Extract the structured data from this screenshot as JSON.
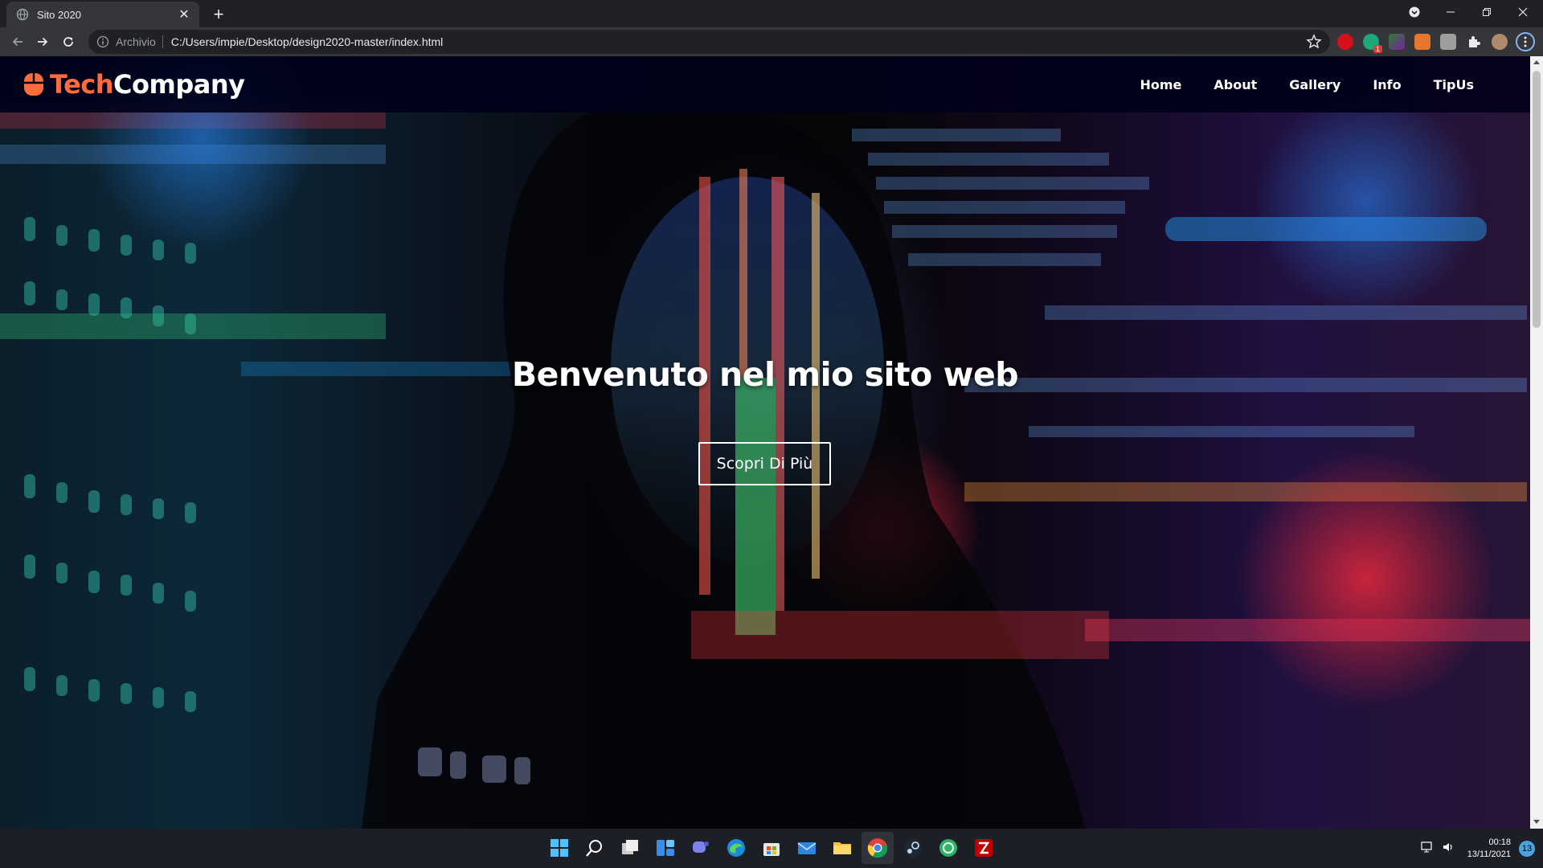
{
  "browser": {
    "tab_title": "Sito 2020",
    "new_tab_label": "+",
    "security_chip": "Archivio",
    "url": "C:/Users/impie/Desktop/design2020-master/index.html",
    "extension_badge": "1"
  },
  "site": {
    "logo_part1": "Tech",
    "logo_part2": "Company",
    "nav": [
      "Home",
      "About",
      "Gallery",
      "Info",
      "TipUs"
    ],
    "hero_title": "Benvenuto nel mio sito web",
    "cta_label": "Scopri Di Più",
    "colors": {
      "brand": "#ff6b3d",
      "navbar": "#01011a",
      "text": "#ffffff"
    }
  },
  "taskbar": {
    "apps": [
      "start-icon",
      "search-icon",
      "task-view-icon",
      "widgets-icon",
      "teams-chat-icon",
      "edge-icon",
      "store-icon",
      "mail-icon",
      "file-explorer-icon",
      "chrome-icon",
      "steam-icon",
      "app-icon",
      "filezilla-icon"
    ],
    "time": "00:18",
    "date": "13/11/2021",
    "notifications": "13"
  }
}
